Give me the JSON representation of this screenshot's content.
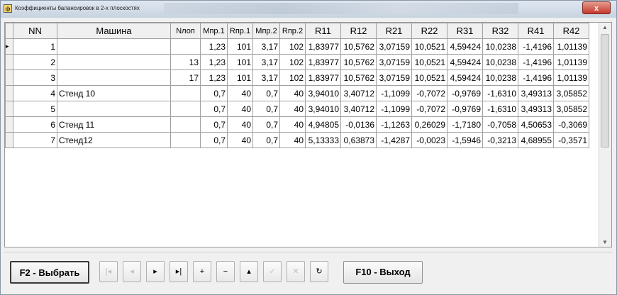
{
  "window": {
    "title": "Коэффициенты балансировок в 2-х плоскостях",
    "close_label": "x"
  },
  "grid": {
    "columns": [
      "NN",
      "Машина",
      "Nлоп",
      "Мпр.1",
      "Rпр.1",
      "Мпр.2",
      "Rпр.2",
      "R11",
      "R12",
      "R21",
      "R22",
      "R31",
      "R32",
      "R41",
      "R42"
    ],
    "current_row_indicator": "▸",
    "rows": [
      [
        "1",
        "",
        "",
        "1,23",
        "101",
        "3,17",
        "102",
        "1,83977",
        "10,5762",
        "3,07159",
        "10,0521",
        "4,59424",
        "10,0238",
        "-1,4196",
        "1,01139"
      ],
      [
        "2",
        "",
        "13",
        "1,23",
        "101",
        "3,17",
        "102",
        "1,83977",
        "10,5762",
        "3,07159",
        "10,0521",
        "4,59424",
        "10,0238",
        "-1,4196",
        "1,01139"
      ],
      [
        "3",
        "",
        "17",
        "1,23",
        "101",
        "3,17",
        "102",
        "1,83977",
        "10,5762",
        "3,07159",
        "10,0521",
        "4,59424",
        "10,0238",
        "-1,4196",
        "1,01139"
      ],
      [
        "4",
        "Стенд 10",
        "",
        "0,7",
        "40",
        "0,7",
        "40",
        "3,94010",
        "3,40712",
        "-1,1099",
        "-0,7072",
        "-0,9769",
        "-1,6310",
        "3,49313",
        "3,05852"
      ],
      [
        "5",
        "",
        "",
        "0,7",
        "40",
        "0,7",
        "40",
        "3,94010",
        "3,40712",
        "-1,1099",
        "-0,7072",
        "-0,9769",
        "-1,6310",
        "3,49313",
        "3,05852"
      ],
      [
        "6",
        "Стенд 11",
        "",
        "0,7",
        "40",
        "0,7",
        "40",
        "4,94805",
        "-0,0136",
        "-1,1263",
        "0,26029",
        "-1,7180",
        "-0,7058",
        "4,50653",
        "-0,3069"
      ],
      [
        "7",
        "Стенд12",
        "",
        "0,7",
        "40",
        "0,7",
        "40",
        "5,13333",
        "0,63873",
        "-1,4287",
        "-0,0023",
        "-1,5946",
        "-0,3213",
        "4,68955",
        "-0,3571"
      ]
    ]
  },
  "toolbar": {
    "select_label": "F2 - Выбрать",
    "exit_label": "F10 - Выход",
    "nav": [
      {
        "name": "first-record-icon",
        "glyph": "|◂",
        "enabled": false
      },
      {
        "name": "prior-record-icon",
        "glyph": "◂",
        "enabled": false
      },
      {
        "name": "next-record-icon",
        "glyph": "▸",
        "enabled": true
      },
      {
        "name": "last-record-icon",
        "glyph": "▸|",
        "enabled": true
      },
      {
        "name": "insert-record-icon",
        "glyph": "+",
        "enabled": true
      },
      {
        "name": "delete-record-icon",
        "glyph": "−",
        "enabled": true
      },
      {
        "name": "edit-record-icon",
        "glyph": "▴",
        "enabled": true
      },
      {
        "name": "post-edit-icon",
        "glyph": "✓",
        "enabled": false
      },
      {
        "name": "cancel-edit-icon",
        "glyph": "✕",
        "enabled": false
      },
      {
        "name": "refresh-data-icon",
        "glyph": "↻",
        "enabled": true
      }
    ]
  }
}
